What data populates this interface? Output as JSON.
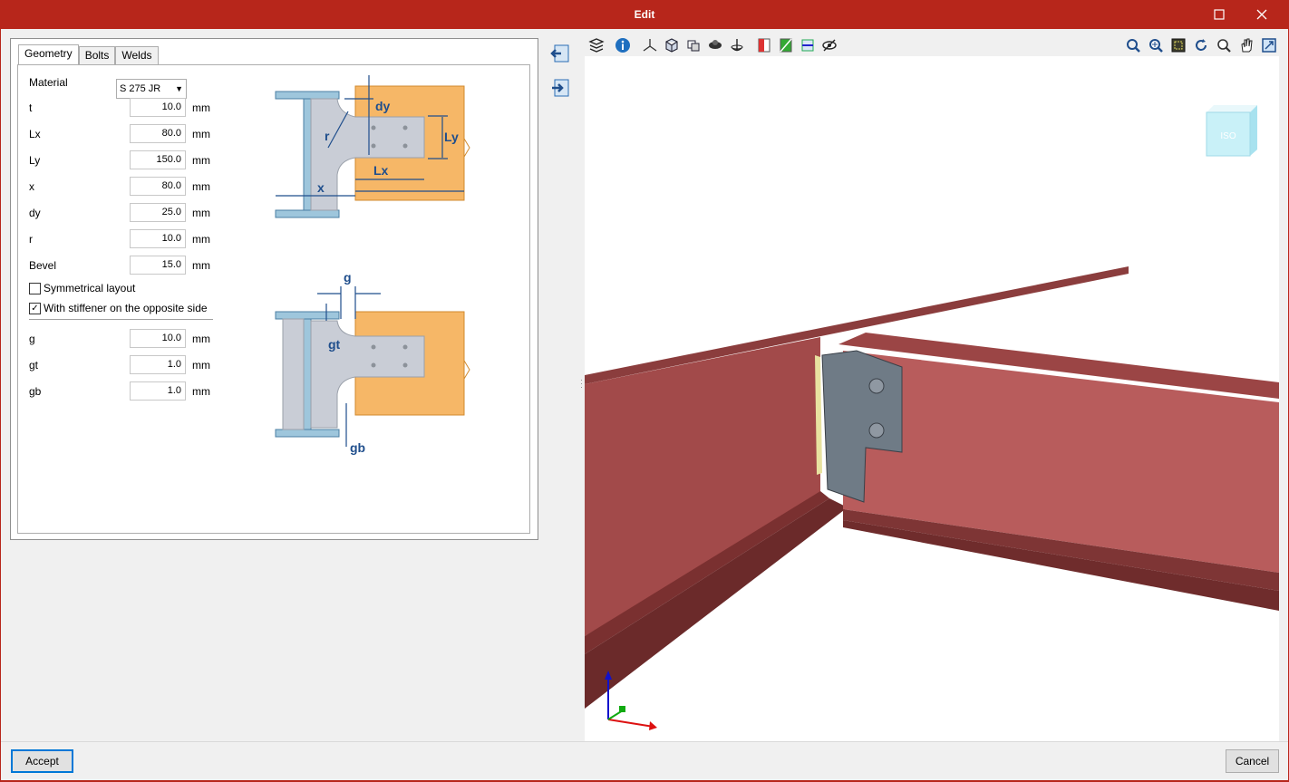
{
  "window": {
    "title": "Edit"
  },
  "tabs": [
    {
      "label": "Geometry"
    },
    {
      "label": "Bolts"
    },
    {
      "label": "Welds"
    }
  ],
  "material": {
    "label": "Material",
    "value": "S 275 JR"
  },
  "params": [
    {
      "label": "t",
      "value": "10.0",
      "unit": "mm"
    },
    {
      "label": "Lx",
      "value": "80.0",
      "unit": "mm"
    },
    {
      "label": "Ly",
      "value": "150.0",
      "unit": "mm"
    },
    {
      "label": "x",
      "value": "80.0",
      "unit": "mm"
    },
    {
      "label": "dy",
      "value": "25.0",
      "unit": "mm"
    },
    {
      "label": "r",
      "value": "10.0",
      "unit": "mm"
    },
    {
      "label": "Bevel",
      "value": "15.0",
      "unit": "mm"
    }
  ],
  "options": [
    {
      "label": "Symmetrical layout",
      "checked": false
    },
    {
      "label": "With stiffener on the opposite side",
      "checked": true
    }
  ],
  "params2": [
    {
      "label": "g",
      "value": "10.0",
      "unit": "mm"
    },
    {
      "label": "gt",
      "value": "1.0",
      "unit": "mm"
    },
    {
      "label": "gb",
      "value": "1.0",
      "unit": "mm"
    }
  ],
  "diagram_labels": {
    "dy": "dy",
    "r": "r",
    "ly": "Ly",
    "lx": "Lx",
    "x": "x",
    "g": "g",
    "gt": "gt",
    "gb": "gb"
  },
  "toolbar": {
    "left_tools": [
      "layers-icon",
      "info-icon",
      "axes-icon",
      "wireframe-icon",
      "render-icon",
      "shade-icon",
      "rotate-icon",
      "clip-icon",
      "section-icon",
      "plane-icon",
      "visibility-icon"
    ],
    "right_tools": [
      "zoom-previous-icon",
      "zoom-window-icon",
      "zoom-all-icon",
      "refresh-icon",
      "zoom-icon",
      "pan-icon",
      "fit-icon"
    ]
  },
  "viewcube": {
    "face": "ISO"
  },
  "buttons": {
    "accept": "Accept",
    "cancel": "Cancel"
  },
  "colors": {
    "titlebar": "#b7261b",
    "beam": "#b05a5a",
    "plate": "#6f7b86",
    "diagram_blue": "#1f4e8c",
    "diagram_orange": "#f6b767",
    "diagram_steel": "#9ec6dc"
  }
}
